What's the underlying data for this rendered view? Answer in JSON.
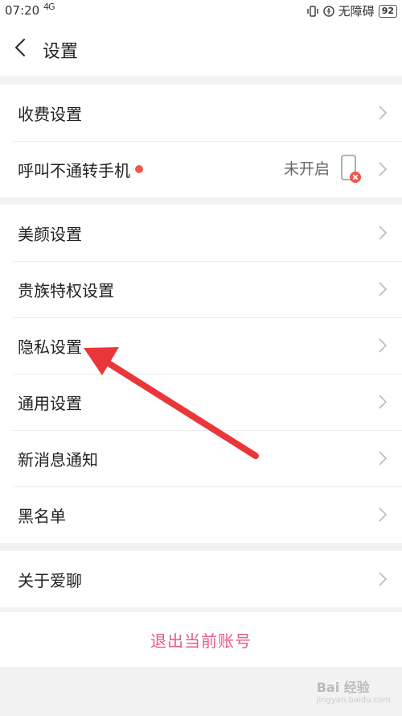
{
  "status_bar": {
    "time": "07:20",
    "signal": "4G",
    "network_label": "无障碍",
    "battery": "92"
  },
  "nav": {
    "title": "设置"
  },
  "groups": [
    {
      "items": [
        {
          "label": "收费设置"
        },
        {
          "label": "呼叫不通转手机",
          "status": "未开启"
        }
      ]
    },
    {
      "items": [
        {
          "label": "美颜设置"
        },
        {
          "label": "贵族特权设置"
        },
        {
          "label": "隐私设置"
        },
        {
          "label": "通用设置"
        },
        {
          "label": "新消息通知"
        },
        {
          "label": "黑名单"
        }
      ]
    },
    {
      "items": [
        {
          "label": "关于爱聊"
        }
      ]
    }
  ],
  "logout": {
    "label": "退出当前账号"
  },
  "colors": {
    "accent": "#e85a86",
    "dot": "#f0584a",
    "arrow": "#e8363a"
  },
  "watermark": {
    "brand": "Bai 经验",
    "url": "jingyan.baidu.com"
  }
}
